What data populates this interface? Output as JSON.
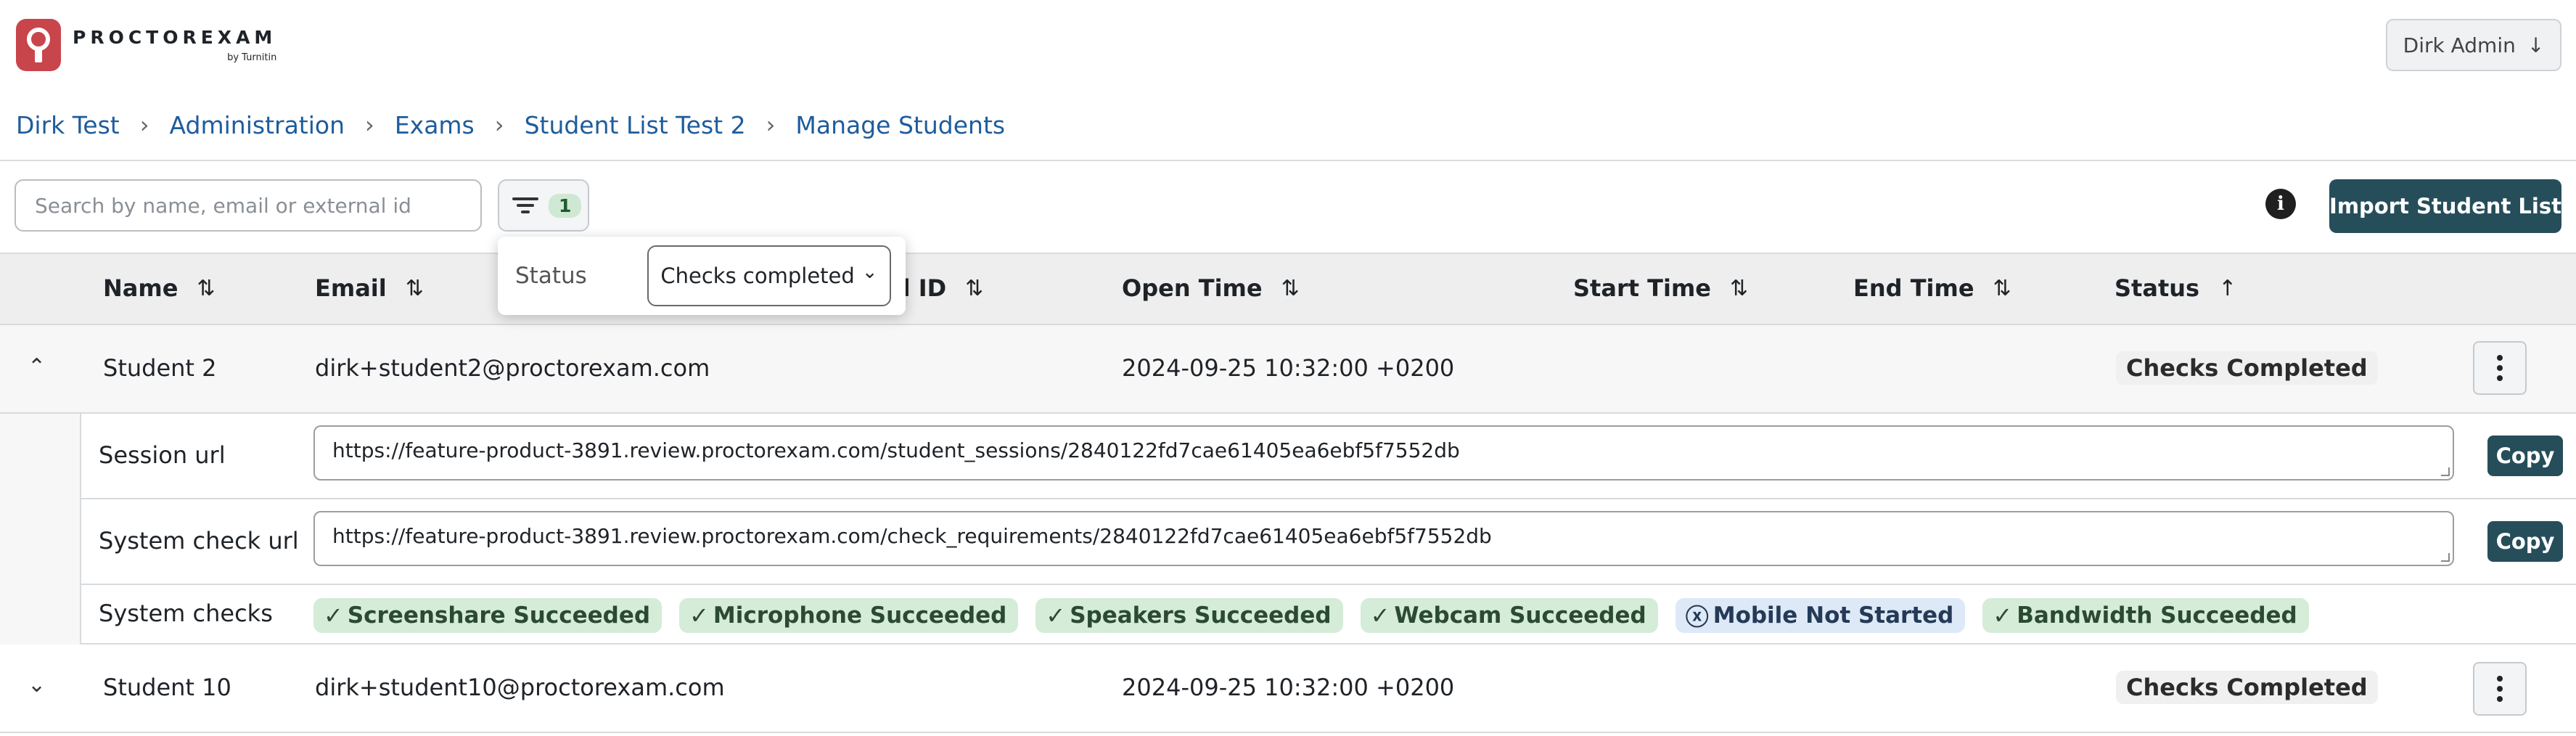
{
  "brand": {
    "name": "PROCTOREXAM",
    "sub": "by Turnitin"
  },
  "user": {
    "label": "Dirk Admin",
    "arrow": "↓"
  },
  "breadcrumb": [
    "Dirk Test",
    "Administration",
    "Exams",
    "Student List Test 2",
    "Manage Students"
  ],
  "search": {
    "placeholder": "Search by name, email or external id",
    "value": ""
  },
  "filter": {
    "count": "1",
    "label": "Status",
    "selected": "Checks completed",
    "chevron": "⌄"
  },
  "toolbar": {
    "info": "i",
    "import_label": "Import Student List"
  },
  "table": {
    "columns": [
      {
        "label": "Name",
        "sort": "⇅"
      },
      {
        "label": "Email",
        "sort": "⇅"
      },
      {
        "label": "External ID",
        "sort": "⇅"
      },
      {
        "label": "Open Time",
        "sort": "⇅"
      },
      {
        "label": "Start Time",
        "sort": "⇅"
      },
      {
        "label": "End Time",
        "sort": "⇅"
      },
      {
        "label": "Status",
        "sort": "↑"
      }
    ],
    "external_id_visible": "al ID",
    "rows": [
      {
        "chevron": "⌃",
        "name": "Student 2",
        "email": "dirk+student2@proctorexam.com",
        "open_time": "2024-09-25 10:32:00 +0200",
        "status": "Checks Completed",
        "details": {
          "session_label": "Session url",
          "session_url": "https://feature-product-3891.review.proctorexam.com/student_sessions/2840122fd7cae61405ea6ebf5f7552db",
          "system_label": "System check url",
          "system_url": "https://feature-product-3891.review.proctorexam.com/check_requirements/2840122fd7cae61405ea6ebf5f7552db",
          "copy_label": "Copy",
          "checks_label": "System checks",
          "checks": [
            {
              "glyph": "✓",
              "label": "Screenshare Succeeded",
              "state": "succeeded"
            },
            {
              "glyph": "✓",
              "label": "Microphone Succeeded",
              "state": "succeeded"
            },
            {
              "glyph": "✓",
              "label": "Speakers Succeeded",
              "state": "succeeded"
            },
            {
              "glyph": "✓",
              "label": "Webcam Succeeded",
              "state": "succeeded"
            },
            {
              "glyph": "ⓧ",
              "label": "Mobile Not Started",
              "state": "not-started"
            },
            {
              "glyph": "✓",
              "label": "Bandwidth Succeeded",
              "state": "succeeded"
            }
          ]
        }
      },
      {
        "chevron": "⌄",
        "name": "Student 10",
        "email": "dirk+student10@proctorexam.com",
        "open_time": "2024-09-25 10:32:00 +0200",
        "status": "Checks Completed"
      }
    ]
  },
  "colors": {
    "accent": "#264e5a",
    "link": "#1e5c9c",
    "logo": "#c8454b",
    "chip_success": "#d5ecd8",
    "chip_info": "#dde9f7"
  }
}
